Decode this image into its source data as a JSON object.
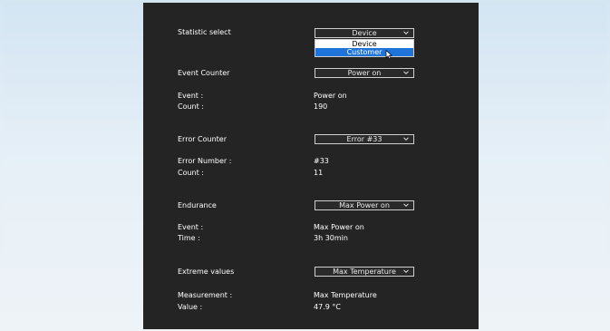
{
  "statistic": {
    "label": "Statistic select",
    "selected": "Device",
    "options": [
      "Device",
      "Customer"
    ],
    "highlighted": "Customer"
  },
  "event_counter": {
    "label": "Event Counter",
    "selected": "Power on",
    "event_label": "Event :",
    "event_value": "Power on",
    "count_label": "Count :",
    "count_value": "190"
  },
  "error_counter": {
    "label": "Error Counter",
    "selected": "Error #33",
    "number_label": "Error Number :",
    "number_value": "#33",
    "count_label": "Count :",
    "count_value": "11"
  },
  "endurance": {
    "label": "Endurance",
    "selected": "Max Power on",
    "event_label": "Event :",
    "event_value": "Max Power on",
    "time_label": "Time :",
    "time_value": "3h 30min"
  },
  "extreme_values": {
    "label": "Extreme values",
    "selected": "Max Temperature",
    "measurement_label": "Measurement :",
    "measurement_value": "Max Temperature",
    "value_label": "Value :",
    "value_value": "47.9 °C"
  },
  "icons": {
    "chevron": "chevron-down-icon",
    "cursor": "mouse-pointer-icon"
  },
  "colors": {
    "panel_bg": "#242424",
    "highlight": "#1f74d9"
  }
}
